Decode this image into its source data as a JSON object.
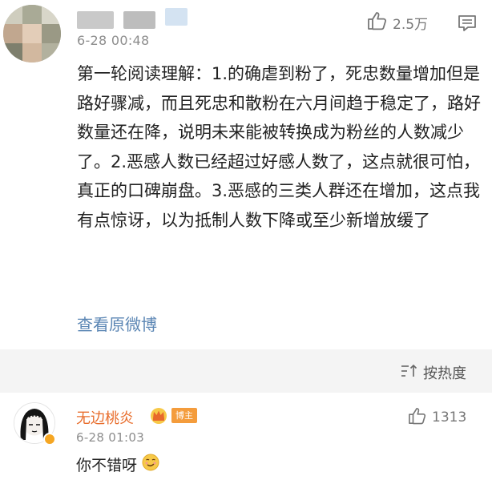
{
  "post": {
    "timestamp": "6-28 00:48",
    "like_count": "2.5万",
    "text": "第一轮阅读理解：1.的确虐到粉了，死忠数量增加但是路好骤减，而且死忠和散粉在六月间趋于稳定了，路好数量还在降，说明未来能被转换成为粉丝的人数减少了。2.恶感人数已经超过好感人数了，这点就很可怕，真正的口碑崩盘。3.恶感的三类人群还在增加，这点我有点惊讶，以为抵制人数下降或至少新增放缓了",
    "view_original": "查看原微博",
    "icons": {
      "like": "thumbs-up-icon",
      "more": "comment-menu-icon"
    }
  },
  "sort": {
    "label": "按热度",
    "icon": "sort-icon"
  },
  "comment": {
    "username": "无边桃炎",
    "badge": "博主",
    "like_count": "1313",
    "timestamp": "6-28 01:03",
    "text": "你不错呀",
    "emoji": "smirk-emoji-icon"
  },
  "colors": {
    "username": "#e86d2c",
    "link": "#5b86b4",
    "badge_bg": "#f49c3c",
    "divider_bg": "#f4f4f4",
    "meta_text": "#8d8d8d"
  }
}
